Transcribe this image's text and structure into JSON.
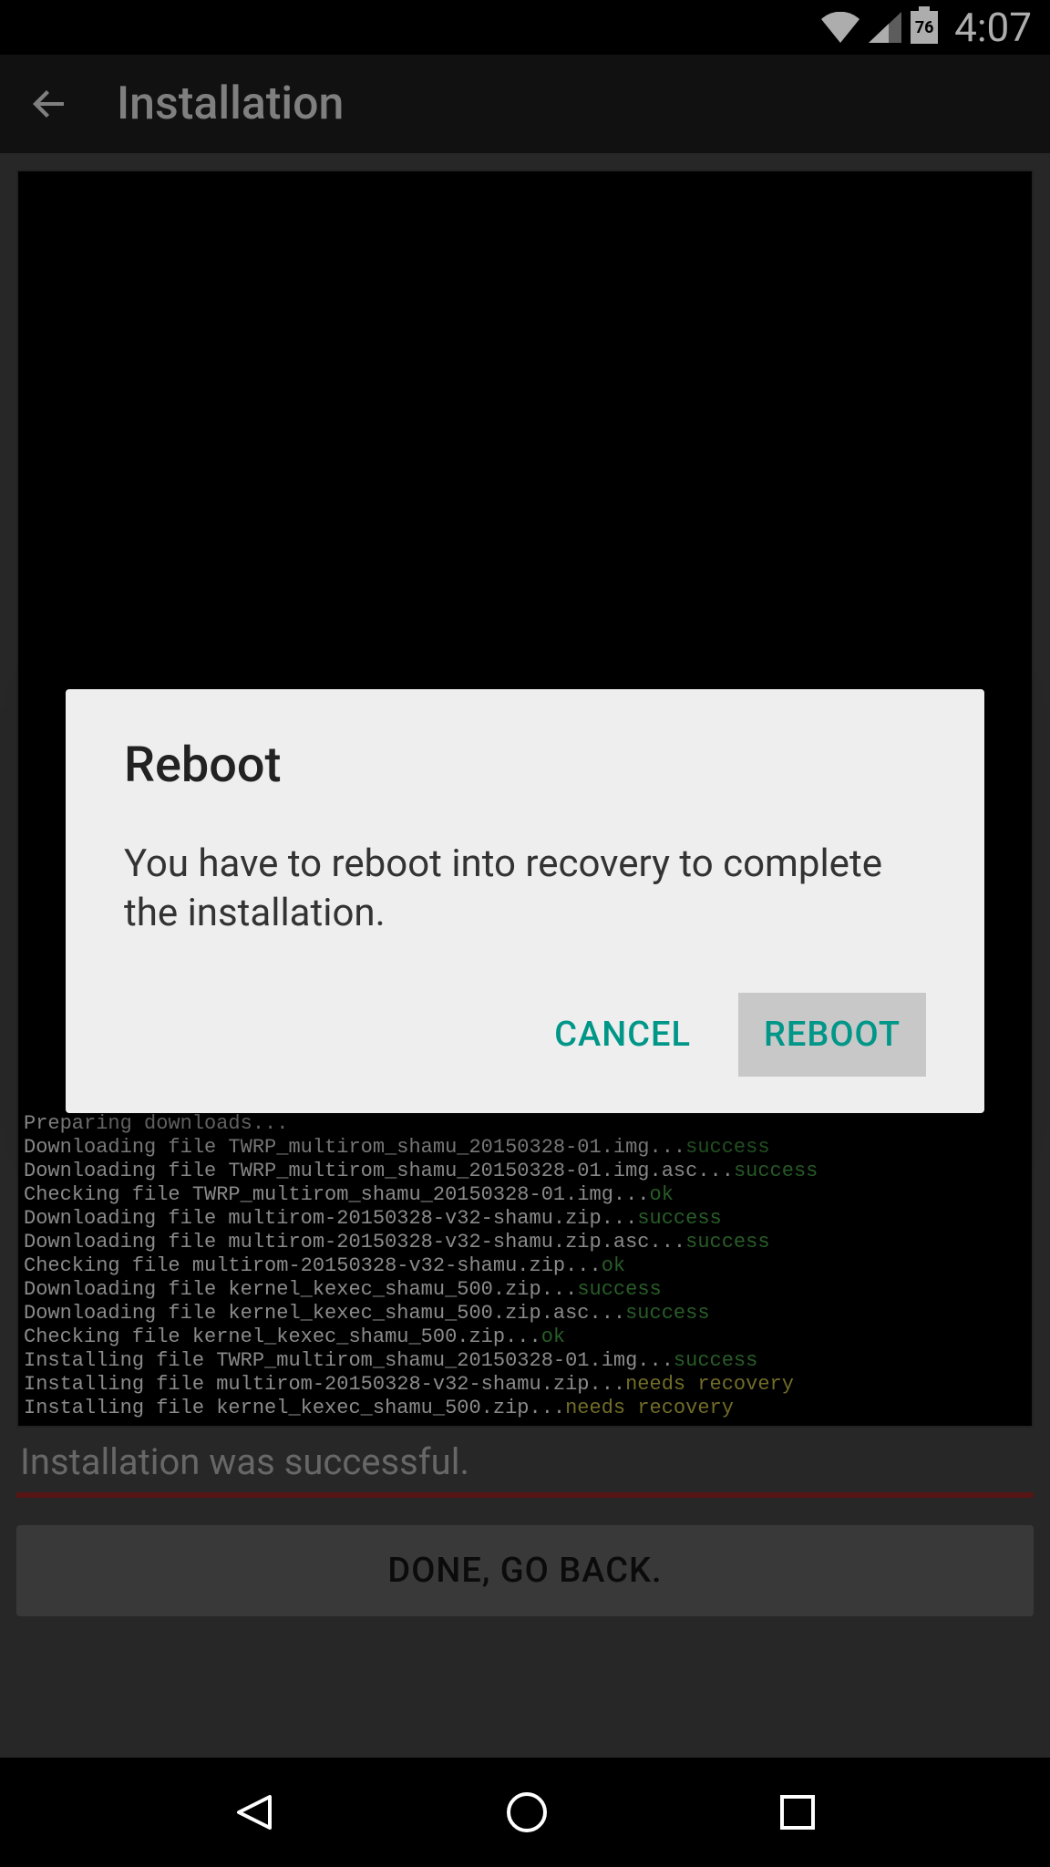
{
  "status_bar": {
    "battery": "76",
    "clock": "4:07"
  },
  "app_bar": {
    "title": "Installation"
  },
  "terminal": {
    "lines": [
      {
        "text": "Preparing downloads...",
        "status": "",
        "status_class": ""
      },
      {
        "text": "Downloading file TWRP_multirom_shamu_20150328-01.img...",
        "status": "success",
        "status_class": "green-text"
      },
      {
        "text": "Downloading file TWRP_multirom_shamu_20150328-01.img.asc...",
        "status": "success",
        "status_class": "green-text"
      },
      {
        "text": "Checking file TWRP_multirom_shamu_20150328-01.img...",
        "status": "ok",
        "status_class": "green-text"
      },
      {
        "text": "Downloading file multirom-20150328-v32-shamu.zip...",
        "status": "success",
        "status_class": "green-text"
      },
      {
        "text": "Downloading file multirom-20150328-v32-shamu.zip.asc...",
        "status": "success",
        "status_class": "green-text"
      },
      {
        "text": "Checking file multirom-20150328-v32-shamu.zip...",
        "status": "ok",
        "status_class": "green-text"
      },
      {
        "text": "Downloading file kernel_kexec_shamu_500.zip...",
        "status": "success",
        "status_class": "green-text"
      },
      {
        "text": "Downloading file kernel_kexec_shamu_500.zip.asc...",
        "status": "success",
        "status_class": "green-text"
      },
      {
        "text": "Checking file kernel_kexec_shamu_500.zip...",
        "status": "ok",
        "status_class": "green-text"
      },
      {
        "text": "Installing file TWRP_multirom_shamu_20150328-01.img...",
        "status": "success",
        "status_class": "green-text"
      },
      {
        "text": "Installing file multirom-20150328-v32-shamu.zip...",
        "status": "needs recovery",
        "status_class": "yellow-text"
      },
      {
        "text": "Installing file kernel_kexec_shamu_500.zip...",
        "status": "needs recovery",
        "status_class": "yellow-text"
      }
    ]
  },
  "status_message": "Installation was successful.",
  "done_button": "DONE, GO BACK.",
  "dialog": {
    "title": "Reboot",
    "message": "You have to reboot into recovery to complete the installation.",
    "cancel": "CANCEL",
    "confirm": "REBOOT"
  }
}
